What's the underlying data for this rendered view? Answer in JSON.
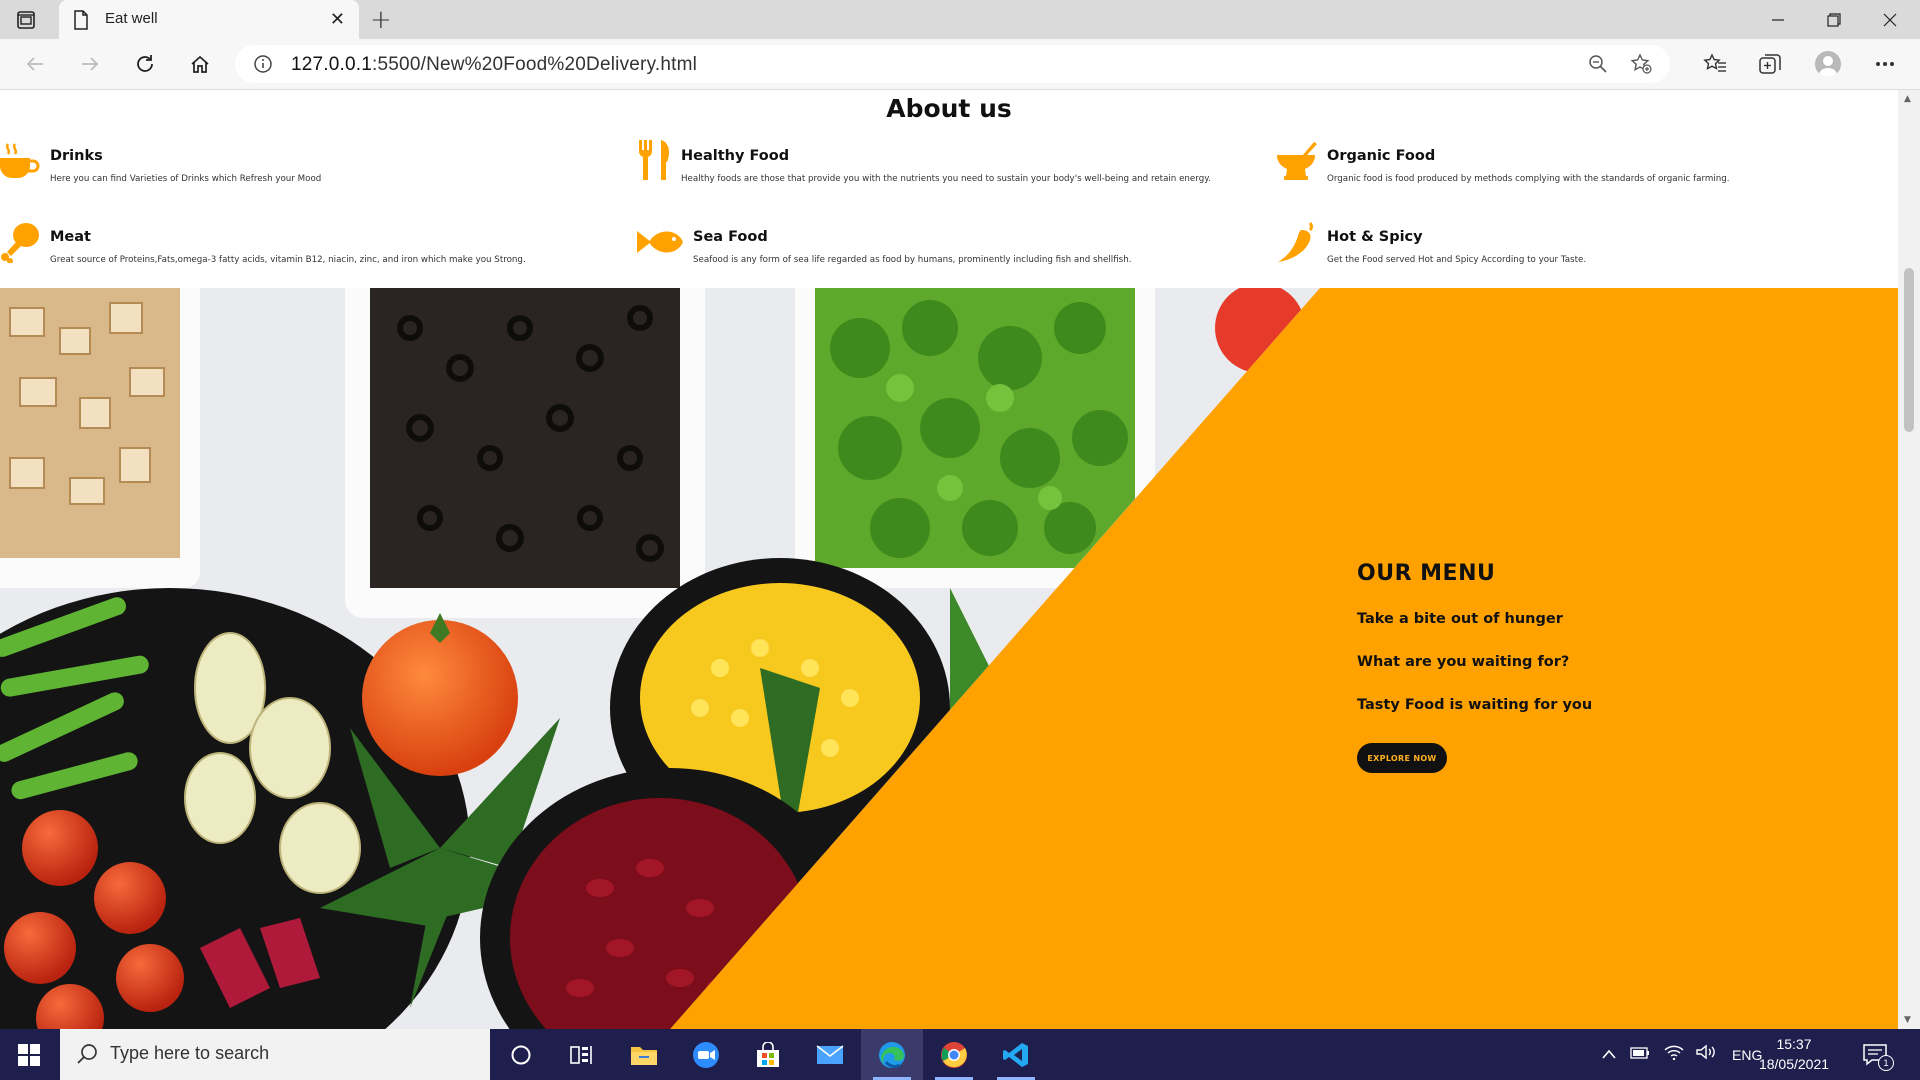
{
  "browser": {
    "tab_title": "Eat well",
    "url_host": "127.0.0.1",
    "url_rest": ":5500/New%20Food%20Delivery.html"
  },
  "page": {
    "about_title": "About us",
    "features": [
      {
        "icon": "cup-icon",
        "name": "Drinks",
        "desc": "Here you can find Varieties of Drinks which Refresh your Mood"
      },
      {
        "icon": "fork-knife-icon",
        "name": "Healthy Food",
        "desc": "Healthy foods are those that provide you with the nutrients you need to sustain your body's well-being and retain energy."
      },
      {
        "icon": "bowl-icon",
        "name": "Organic Food",
        "desc": "Organic food is food produced by methods complying with the standards of organic farming."
      },
      {
        "icon": "drumstick-icon",
        "name": "Meat",
        "desc": "Great source of Proteins,Fats,omega-3 fatty acids, vitamin B12, niacin, zinc, and iron which make you Strong."
      },
      {
        "icon": "fish-icon",
        "name": "Sea Food",
        "desc": "Seafood is any form of sea life regarded as food by humans, prominently including fish and shellfish."
      },
      {
        "icon": "chili-icon",
        "name": "Hot & Spicy",
        "desc": "Get the Food served Hot and Spicy According to your Taste."
      }
    ],
    "menu": {
      "title": "OUR MENU",
      "lines": [
        "Take a bite out of hunger",
        "What are you waiting for?",
        "Tasty Food is waiting for you"
      ],
      "button": "EXPLORE NOW"
    },
    "colors": {
      "accent": "#ffa200",
      "dark": "#111111"
    }
  },
  "taskbar": {
    "search_placeholder": "Type here to search",
    "lang": "ENG",
    "time": "15:37",
    "date": "18/05/2021",
    "notification_count": "1"
  }
}
